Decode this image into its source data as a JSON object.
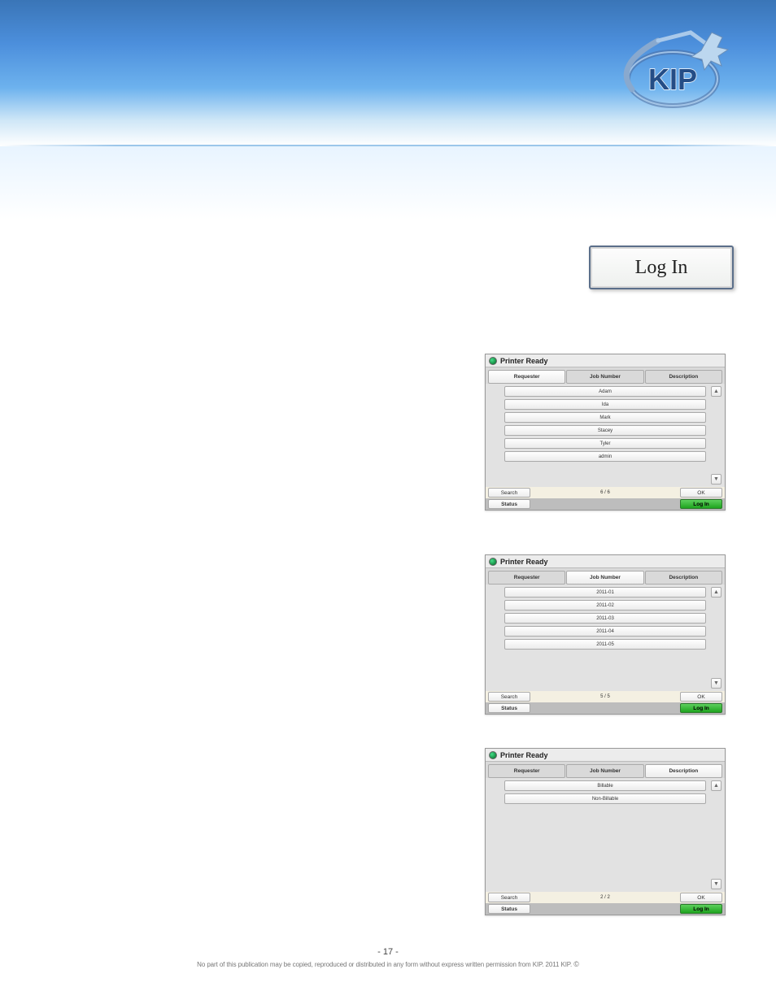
{
  "brand": "KIP",
  "login_button_label": "Log In",
  "shot_common": {
    "header_title": "Printer Ready",
    "tabs": {
      "requester": "Requester",
      "job_number": "Job Number",
      "description": "Description"
    },
    "search_label": "Search",
    "ok_label": "OK",
    "status_label": "Status",
    "login_label": "Log In"
  },
  "shot1": {
    "active_tab": "requester",
    "rows": [
      "Adam",
      "Ida",
      "Mark",
      "Stacey",
      "Tyler",
      "admin"
    ],
    "pager": "6 / 6"
  },
  "shot2": {
    "active_tab": "job_number",
    "rows": [
      "2011-01",
      "2011-02",
      "2011-03",
      "2011-04",
      "2011-05"
    ],
    "pager": "5 / 5"
  },
  "shot3": {
    "active_tab": "description",
    "rows": [
      "Billable",
      "Non-Billable"
    ],
    "pager": "2 / 2"
  },
  "page_number": "- 17 -",
  "copyright": "No part of this publication may be copied, reproduced or distributed in any form without express written permission from KIP.    2011 KIP."
}
